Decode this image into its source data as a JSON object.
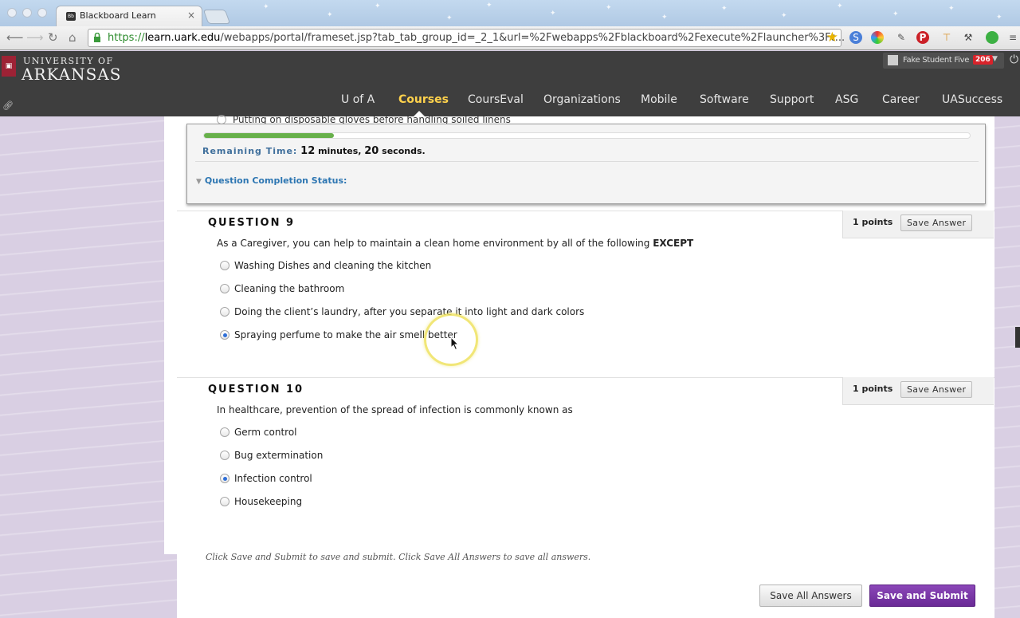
{
  "browser": {
    "tab_title": "Blackboard Learn",
    "tab_close": "×",
    "url_scheme": "https://",
    "url_host": "learn.uark.edu",
    "url_path": "/webapps/portal/frameset.jsp?tab_tab_group_id=_2_1&url=%2Fwebapps%2Fblackboard%2Fexecute%2Flauncher%3Ft..."
  },
  "header": {
    "logo_line1": "UNIVERSITY OF",
    "logo_line2": "ARKANSAS",
    "user_name": "Fake Student Five",
    "notification_count": "206",
    "nav": [
      "U of A",
      "Courses",
      "CoursEval",
      "Organizations",
      "Mobile",
      "Software",
      "Support",
      "ASG",
      "Career",
      "UASuccess"
    ],
    "active_nav": "Courses"
  },
  "timer": {
    "progress_fraction": 0.17,
    "remaining_label": "Remaining Time:",
    "minutes": "12",
    "minutes_unit": "minutes,",
    "seconds": "20",
    "seconds_unit": "seconds.",
    "status_label": "Question Completion Status:"
  },
  "previous_option_cutoff": "Putting on disposable gloves before handling soiled linens",
  "questions": [
    {
      "title": "QUESTION 9",
      "points": "1 points",
      "save_label": "Save Answer",
      "text_prefix": "As a Caregiver, you can help to maintain a clean home environment by all of the following ",
      "text_bold": "EXCEPT",
      "options": [
        "Washing Dishes and cleaning the kitchen",
        "Cleaning the bathroom",
        "Doing the client’s laundry, after you separate it into light and dark colors",
        "Spraying perfume to make the air smell better"
      ],
      "selected": 3
    },
    {
      "title": "QUESTION 10",
      "points": "1 points",
      "save_label": "Save Answer",
      "text_prefix": "In healthcare, prevention of the spread of infection is commonly known as",
      "text_bold": "",
      "options": [
        "Germ control",
        "Bug extermination",
        "Infection control",
        "Housekeeping"
      ],
      "selected": 2
    }
  ],
  "footer": {
    "note": "Click Save and Submit to save and submit. Click Save All Answers to save all answers.",
    "save_all_label": "Save All Answers",
    "submit_label": "Save and Submit"
  }
}
